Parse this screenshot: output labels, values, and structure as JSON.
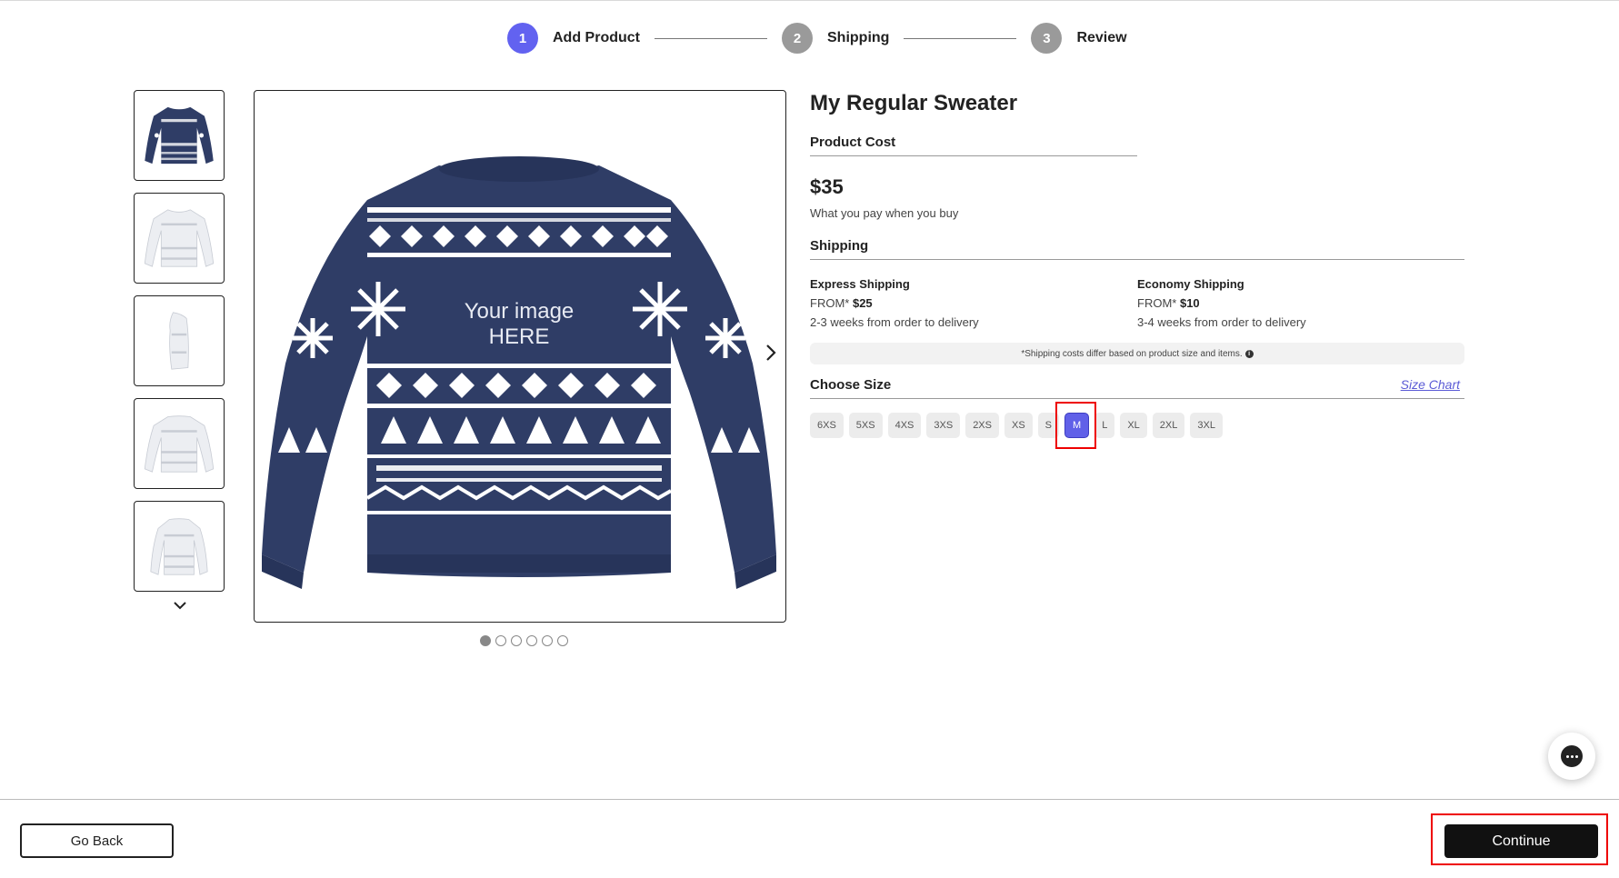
{
  "stepper": {
    "steps": [
      {
        "number": "1",
        "label": "Add Product",
        "state": "active",
        "color": "#6262f0"
      },
      {
        "number": "2",
        "label": "Shipping",
        "state": "inactive",
        "color": "#9a9a9a"
      },
      {
        "number": "3",
        "label": "Review",
        "state": "inactive",
        "color": "#9a9a9a"
      }
    ]
  },
  "gallery": {
    "main_overlay_line1": "Your image",
    "main_overlay_line2": "HERE",
    "thumbnails": [
      "sweater-front-navy",
      "sweater-front-white",
      "sweater-side-white",
      "sweater-back-white",
      "sweater-back-white-2"
    ],
    "carousel_dots": 6,
    "active_dot": 1
  },
  "product": {
    "title": "My Regular Sweater",
    "cost_label": "Product Cost",
    "price": "$35",
    "price_note": "What you pay when you buy"
  },
  "shipping": {
    "heading": "Shipping",
    "express": {
      "title": "Express Shipping",
      "from_label": "FROM*",
      "price": "$25",
      "time": "2-3 weeks from order to delivery"
    },
    "economy": {
      "title": "Economy Shipping",
      "from_label": "FROM*",
      "price": "$10",
      "time": "3-4 weeks from order to delivery"
    },
    "note": "*Shipping costs differ based on product size and items."
  },
  "size": {
    "heading": "Choose Size",
    "chart_link": "Size Chart",
    "options": [
      "6XS",
      "5XS",
      "4XS",
      "3XS",
      "2XS",
      "XS",
      "S",
      "M",
      "L",
      "XL",
      "2XL",
      "3XL"
    ],
    "selected": "M"
  },
  "footer": {
    "back_label": "Go Back",
    "continue_label": "Continue"
  },
  "colors": {
    "accent": "#6262f0",
    "sweater_navy": "#2f3d66",
    "highlight": "#e00000"
  }
}
